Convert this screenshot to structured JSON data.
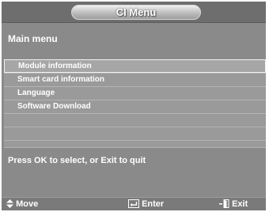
{
  "header": {
    "title": "CI Menu"
  },
  "section": {
    "title": "Main menu"
  },
  "menu": {
    "items": [
      {
        "label": "Module information",
        "selected": true
      },
      {
        "label": "Smart card information",
        "selected": false
      },
      {
        "label": "Language",
        "selected": false
      },
      {
        "label": "Software Download",
        "selected": false
      },
      {
        "label": "",
        "selected": false
      },
      {
        "label": "",
        "selected": false
      },
      {
        "label": "",
        "selected": false
      }
    ]
  },
  "help": {
    "text": "Press OK to select, or Exit to quit"
  },
  "footer": {
    "move_label": "Move",
    "enter_label": "Enter",
    "exit_label": "Exit",
    "move_icon": "up-down-arrows-icon",
    "enter_icon": "enter-icon",
    "exit_icon": "exit-icon"
  },
  "colors": {
    "panel": "#8a8a8a",
    "title_band": "#6e6e6e",
    "text": "#ffffff",
    "selection_border": "#f2f2f2"
  }
}
